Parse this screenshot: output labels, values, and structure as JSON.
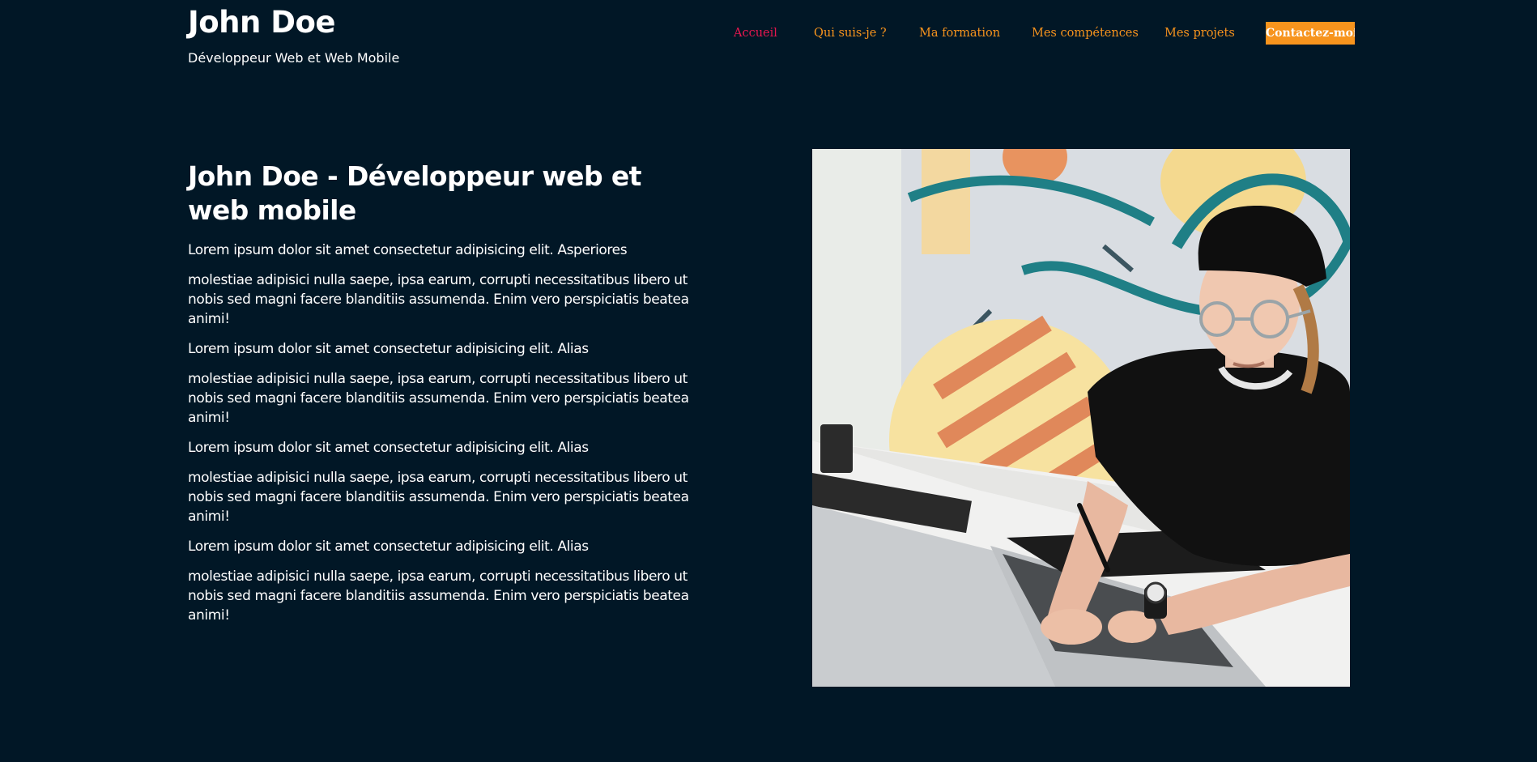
{
  "header": {
    "name": "John Doe",
    "tagline": "Développeur Web et Web Mobile"
  },
  "nav": {
    "items": [
      {
        "label": "Accueil",
        "active": true
      },
      {
        "label": "Qui suis-je ?"
      },
      {
        "label": "Ma formation"
      },
      {
        "label": "Mes compétences"
      },
      {
        "label": "Mes projets"
      }
    ],
    "cta_label": "Contactez-moi"
  },
  "hero": {
    "title": "John Doe - Développeur web et web mobile",
    "paragraphs": [
      "Lorem ipsum dolor sit amet consectetur adipisicing elit. Asperiores",
      "molestiae adipisici nulla saepe, ipsa earum, corrupti necessitatibus libero ut nobis sed magni facere blanditiis assumenda. Enim vero perspiciatis beatea animi!",
      "Lorem ipsum dolor sit amet consectetur adipisicing elit. Alias",
      "molestiae adipisici nulla saepe, ipsa earum, corrupti necessitatibus libero ut nobis sed magni facere blanditiis assumenda. Enim vero perspiciatis beatea animi!",
      "Lorem ipsum dolor sit amet consectetur adipisicing elit. Alias",
      "molestiae adipisici nulla saepe, ipsa earum, corrupti necessitatibus libero ut nobis sed magni facere blanditiis assumenda. Enim vero perspiciatis beatea animi!",
      "Lorem ipsum dolor sit amet consectetur adipisicing elit. Alias",
      "molestiae adipisici nulla saepe, ipsa earum, corrupti necessitatibus libero ut nobis sed magni facere blanditiis assumenda. Enim vero perspiciatis beatea animi!"
    ]
  },
  "colors": {
    "background": "#011726",
    "accent": "#f7941d",
    "active_link": "#e8174f",
    "text": "#ffffff"
  }
}
